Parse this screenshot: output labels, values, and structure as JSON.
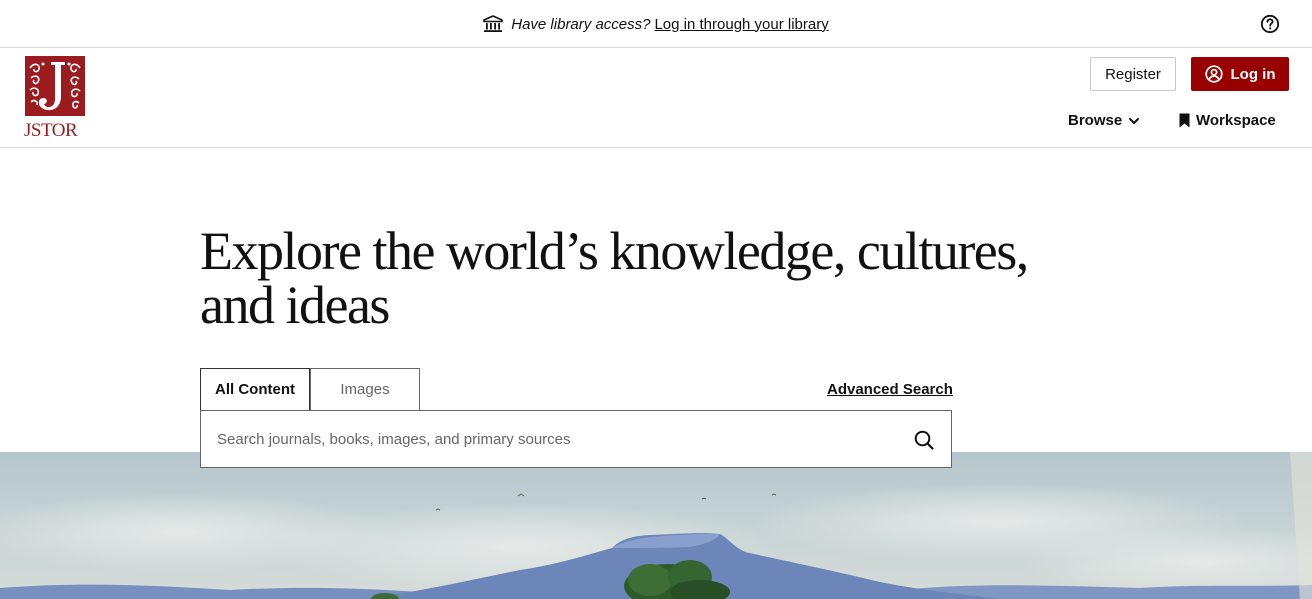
{
  "banner": {
    "question": "Have library access?",
    "link": "Log in through your library",
    "icons": {
      "library": "library-building-icon",
      "help": "help-circle-icon"
    }
  },
  "header": {
    "logo_text": "JSTOR",
    "register_label": "Register",
    "login_label": "Log in",
    "nav": {
      "browse": "Browse",
      "workspace": "Workspace"
    }
  },
  "hero": {
    "title_line1": "Explore the world’s knowledge, cultures,",
    "title_line2": "and ideas"
  },
  "search": {
    "tabs": [
      {
        "label": "All Content",
        "active": true
      },
      {
        "label": "Images",
        "active": false
      }
    ],
    "advanced_label": "Advanced Search",
    "placeholder": "Search journals, books, images, and primary sources"
  },
  "colors": {
    "brand_red": "#9b1b1e",
    "button_red": "#990000",
    "border": "#d9d9d9",
    "sky": "#b9c9cf",
    "mountain": "#6d87b8"
  }
}
